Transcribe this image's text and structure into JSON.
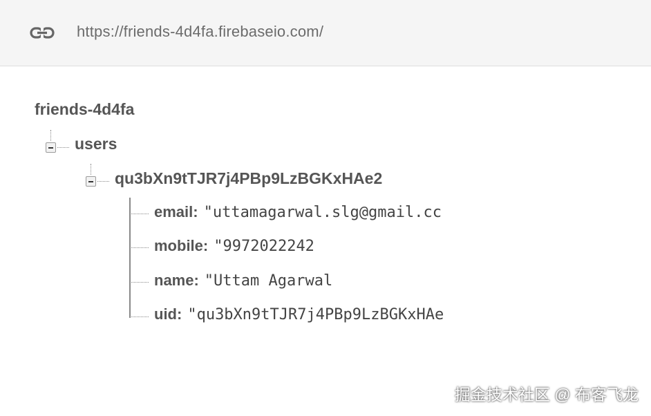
{
  "url_bar": {
    "icon": "link-icon",
    "url": "https://friends-4d4fa.firebaseio.com/"
  },
  "tree": {
    "root": "friends-4d4fa",
    "users": {
      "label": "users",
      "child": {
        "label": "qu3bXn9tTJR7j4PBp9LzBGKxHAe2",
        "fields": [
          {
            "key": "email:",
            "value": "\"uttamagarwal.slg@gmail.cc"
          },
          {
            "key": "mobile:",
            "value": "\"9972022242"
          },
          {
            "key": "name:",
            "value": "\"Uttam Agarwal"
          },
          {
            "key": "uid:",
            "value": "\"qu3bXn9tTJR7j4PBp9LzBGKxHAe"
          }
        ]
      }
    }
  },
  "watermark": "掘金技术社区 @ 布客飞龙",
  "colors": {
    "url_bar_bg": "#f5f5f5",
    "label": "#555555",
    "value": "#444444"
  }
}
